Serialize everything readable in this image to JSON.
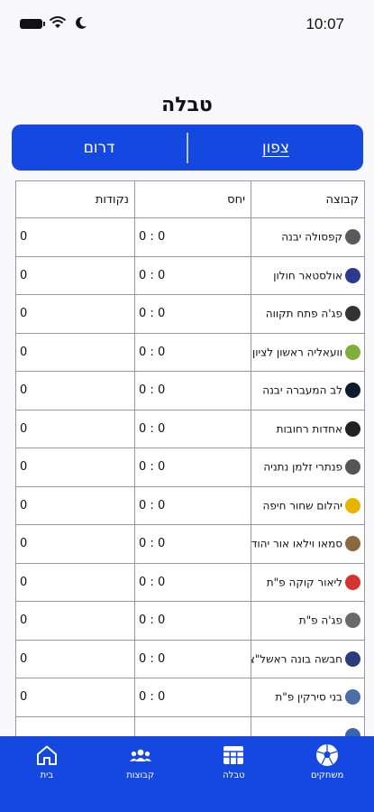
{
  "status": {
    "time": "10:07"
  },
  "page_title": "טבלה",
  "tabs": [
    {
      "label": "צפון",
      "active": true
    },
    {
      "label": "דרום",
      "active": false
    }
  ],
  "table": {
    "headers": [
      "קבוצה",
      "יחס",
      "נקודות"
    ],
    "rows": [
      {
        "team": "קפסולה יבנה",
        "ratio": "0 : 0",
        "points": "0",
        "logo_color": "#5a5a5a"
      },
      {
        "team": "אולסטאר חולון",
        "ratio": "0 : 0",
        "points": "0",
        "logo_color": "#2b3a8f"
      },
      {
        "team": "פג'ה פתח תקווה",
        "ratio": "0 : 0",
        "points": "0",
        "logo_color": "#333333"
      },
      {
        "team": "וועאליה ראשון לציון",
        "ratio": "0 : 0",
        "points": "0",
        "logo_color": "#7fae3a"
      },
      {
        "team": "לב המעברה יבנה",
        "ratio": "0 : 0",
        "points": "0",
        "logo_color": "#0d1b2e"
      },
      {
        "team": "אחדות רחובות",
        "ratio": "0 : 0",
        "points": "0",
        "logo_color": "#222222"
      },
      {
        "team": "פנתרי זלמן נתניה",
        "ratio": "0 : 0",
        "points": "0",
        "logo_color": "#555555"
      },
      {
        "team": "יהלום שחור חיפה",
        "ratio": "0 : 0",
        "points": "0",
        "logo_color": "#e8b400"
      },
      {
        "team": "סמאו וילאו אור יהודה",
        "ratio": "0 : 0",
        "points": "0",
        "logo_color": "#8a6a3c"
      },
      {
        "team": "ליאור קוקה פ\"ת",
        "ratio": "0 : 0",
        "points": "0",
        "logo_color": "#d8322c"
      },
      {
        "team": "פג'ה פ\"ת",
        "ratio": "0 : 0",
        "points": "0",
        "logo_color": "#6a6a6a"
      },
      {
        "team": "חבשה בונה ראשל\"צ",
        "ratio": "0 : 0",
        "points": "0",
        "logo_color": "#2a3d7a"
      },
      {
        "team": "בני סירקין פ\"ת",
        "ratio": "0 : 0",
        "points": "0",
        "logo_color": "#4a6fa8"
      },
      {
        "team": "",
        "ratio": "",
        "points": "",
        "logo_color": "#3c63b0"
      }
    ]
  },
  "nav": [
    {
      "label": "משחקים",
      "icon": "soccer-ball-icon"
    },
    {
      "label": "טבלה",
      "icon": "table-icon"
    },
    {
      "label": "קבוצות",
      "icon": "groups-icon"
    },
    {
      "label": "בית",
      "icon": "home-icon"
    }
  ]
}
